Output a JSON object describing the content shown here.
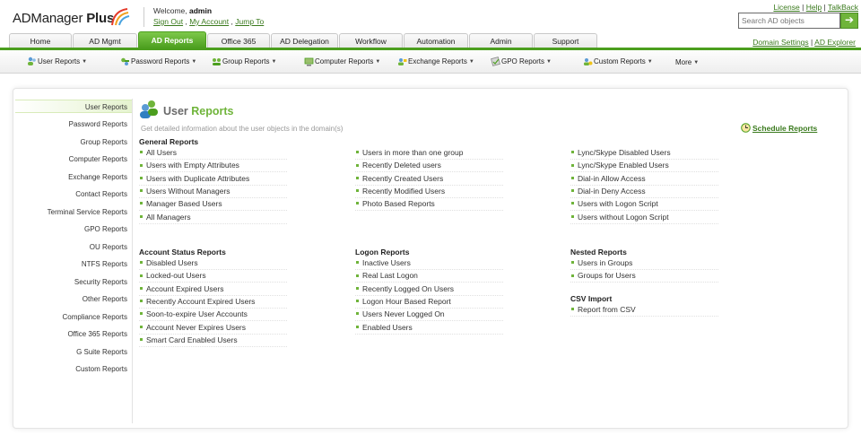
{
  "header": {
    "app_name_regular": "ADManager",
    "app_name_bold": " Plus",
    "welcome_prefix": "Welcome,",
    "username": "admin",
    "sign_out": "Sign Out",
    "my_account": "My Account",
    "jump_to": "Jump To",
    "link_sep1": ",",
    "link_sep2": ",",
    "license": "License",
    "help": "Help",
    "talkback": "TalkBack",
    "pipe": "|",
    "search_placeholder": "Search AD objects",
    "search_go": "➔"
  },
  "tabs": [
    {
      "label": "Home"
    },
    {
      "label": "AD Mgmt"
    },
    {
      "label": "AD Reports",
      "active": true
    },
    {
      "label": "Office 365"
    },
    {
      "label": "AD Delegation"
    },
    {
      "label": "Workflow"
    },
    {
      "label": "Automation"
    },
    {
      "label": "Admin"
    },
    {
      "label": "Support"
    }
  ],
  "domain_links": {
    "domain_settings": "Domain Settings",
    "pipe": "|",
    "ad_explorer": "AD Explorer"
  },
  "submenu": [
    {
      "label": "User Reports",
      "icon": "users-icon"
    },
    {
      "label": "Password Reports",
      "icon": "key-icon"
    },
    {
      "label": "Group Reports",
      "icon": "group-icon"
    },
    {
      "label": "Computer Reports",
      "icon": "computer-icon"
    },
    {
      "label": "Exchange Reports",
      "icon": "exchange-icon"
    },
    {
      "label": "GPO Reports",
      "icon": "gpo-icon"
    },
    {
      "label": "Custom Reports",
      "icon": "custom-icon"
    },
    {
      "label": "More"
    }
  ],
  "sidebar": {
    "items": [
      {
        "label": "User Reports",
        "active": true
      },
      {
        "label": "Password Reports"
      },
      {
        "label": "Group Reports"
      },
      {
        "label": "Computer Reports"
      },
      {
        "label": "Exchange Reports"
      },
      {
        "label": "Contact Reports"
      },
      {
        "label": "Terminal Service Reports"
      },
      {
        "label": "GPO Reports"
      },
      {
        "label": "OU Reports"
      },
      {
        "label": "NTFS Reports"
      },
      {
        "label": "Security Reports"
      },
      {
        "label": "Other Reports"
      },
      {
        "label": "Compliance Reports"
      },
      {
        "label": "Office 365 Reports"
      },
      {
        "label": "G Suite Reports"
      },
      {
        "label": "Custom Reports"
      }
    ]
  },
  "main": {
    "title_gray": "User",
    "title_green": "Reports",
    "description": "Get detailed information about the user objects in the domain(s)",
    "schedule": "Schedule Reports",
    "general": {
      "title": "General Reports",
      "col1": [
        "All Users",
        "Users with Empty Attributes",
        "Users with Duplicate Attributes",
        "Users Without Managers",
        "Manager Based Users",
        "All Managers"
      ],
      "col2": [
        "Users in more than one group",
        "Recently Deleted users",
        "Recently Created Users",
        "Recently Modified Users",
        "Photo Based Reports"
      ],
      "col3": [
        "Lync/Skype Disabled Users",
        "Lync/Skype Enabled Users",
        "Dial-in Allow Access",
        "Dial-in Deny Access",
        "Users with Logon Script",
        "Users without Logon Script"
      ]
    },
    "account_status": {
      "title": "Account Status Reports",
      "items": [
        "Disabled Users",
        "Locked-out Users",
        "Account Expired Users",
        "Recently Account Expired Users",
        "Soon-to-expire User Accounts",
        "Account Never Expires Users",
        "Smart Card Enabled Users"
      ]
    },
    "logon": {
      "title": "Logon Reports",
      "items": [
        "Inactive Users",
        "Real Last Logon",
        "Recently Logged On Users",
        "Logon Hour Based Report",
        "Users Never Logged On",
        "Enabled Users"
      ]
    },
    "nested": {
      "title": "Nested Reports",
      "items": [
        "Users in Groups",
        "Groups for Users"
      ]
    },
    "csv": {
      "title": "CSV Import",
      "items": [
        "Report from CSV"
      ]
    }
  },
  "colors": {
    "accent": "#6fb43a",
    "accent_dark": "#4b9e1e",
    "link": "#3a7a1d"
  }
}
